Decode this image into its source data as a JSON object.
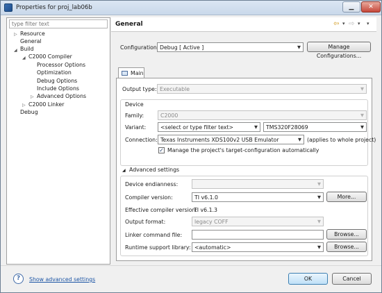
{
  "window": {
    "title": "Properties for proj_lab06b",
    "minimize_glyph": "▁",
    "close_glyph": "✕"
  },
  "tree": {
    "filter_placeholder": "type filter text",
    "items": [
      {
        "label": "Resource",
        "arrow": "▷"
      },
      {
        "label": "General"
      },
      {
        "label": "Build",
        "arrow": "◢"
      },
      {
        "label": "C2000 Compiler",
        "arrow": "◢"
      },
      {
        "label": "Processor Options"
      },
      {
        "label": "Optimization"
      },
      {
        "label": "Debug Options"
      },
      {
        "label": "Include Options"
      },
      {
        "label": "Advanced Options",
        "arrow": "▷"
      },
      {
        "label": "C2000 Linker",
        "arrow": "▷"
      },
      {
        "label": "Debug"
      }
    ]
  },
  "page": {
    "title": "General",
    "nav": {
      "back": "⇦",
      "back_drop": "▾",
      "forward": "⇨",
      "forward_drop": "▾",
      "menu": "▾"
    },
    "configuration": {
      "label": "Configuration:",
      "value": "Debug  [ Active ]",
      "manage_button": "Manage Configurations..."
    },
    "tab": {
      "label": "Main"
    },
    "output_type": {
      "label": "Output type:",
      "value": "Executable"
    },
    "device": {
      "heading": "Device",
      "family": {
        "label": "Family:",
        "value": "C2000"
      },
      "variant": {
        "label": "Variant:",
        "filter_value": "<select or type filter text>",
        "value": "TMS320F28069"
      },
      "connection": {
        "label": "Connection:",
        "value": "Texas Instruments XDS100v2 USB Emulator",
        "note": "(applies to whole project)"
      },
      "manage_checkbox": {
        "label": "Manage the project's target-configuration automatically",
        "checked": true,
        "glyph": "✓"
      }
    },
    "advanced": {
      "heading": "Advanced settings",
      "toggle_glyph": "◢",
      "endianness": {
        "label": "Device endianness:",
        "value": ""
      },
      "compiler_version": {
        "label": "Compiler version:",
        "value": "TI v6.1.0",
        "button": "More..."
      },
      "effective_compiler": {
        "label": "Effective compiler version:",
        "value": "TI v6.1.3"
      },
      "output_format": {
        "label": "Output format:",
        "value": "legacy COFF"
      },
      "linker_command_file": {
        "label": "Linker command file:",
        "value": "",
        "button": "Browse..."
      },
      "runtime_library": {
        "label": "Runtime support library:",
        "value": "<automatic>",
        "button": "Browse..."
      }
    }
  },
  "footer": {
    "help_glyph": "?",
    "show_advanced_link": "Show advanced settings",
    "ok_button": "OK",
    "cancel_button": "Cancel"
  },
  "colors": {
    "link": "#1c55a5",
    "nav_back": "#d29a1c",
    "window_border": "#6d7f93"
  }
}
